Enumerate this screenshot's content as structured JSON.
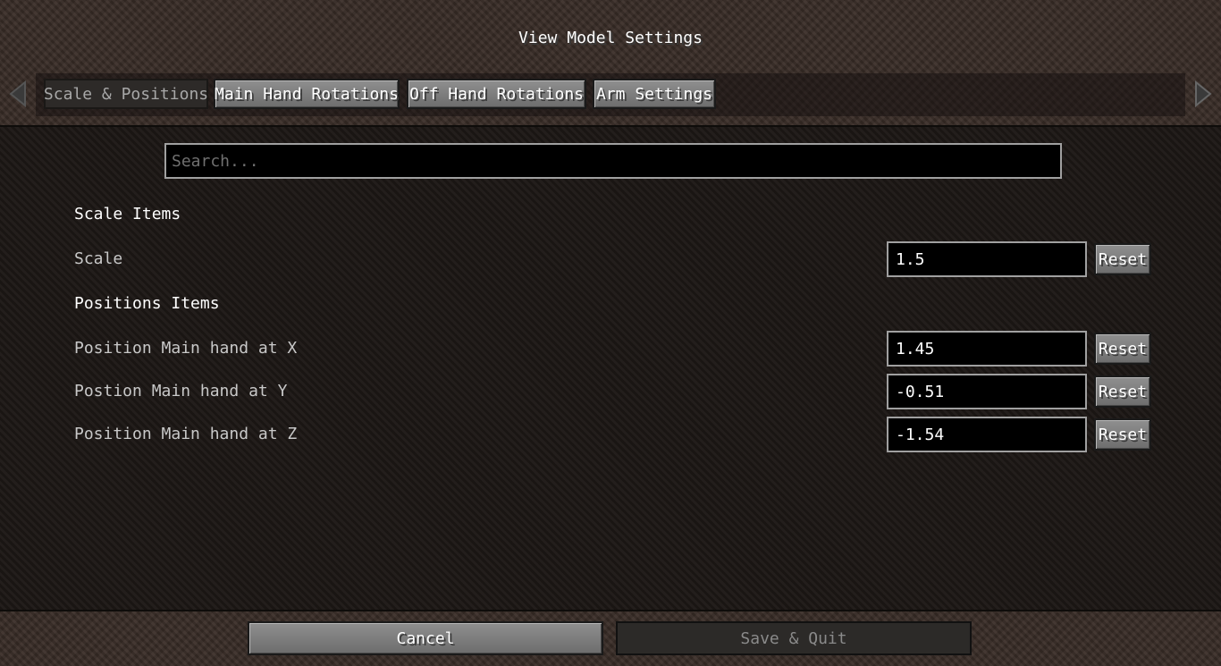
{
  "window": {
    "title": "View Model Settings"
  },
  "tabs": [
    {
      "label": "Scale & Positions",
      "active": true
    },
    {
      "label": "Main Hand Rotations",
      "active": false
    },
    {
      "label": "Off Hand Rotations",
      "active": false
    },
    {
      "label": "Arm Settings",
      "active": false
    }
  ],
  "search": {
    "placeholder": "Search...",
    "value": ""
  },
  "sections": {
    "scale": {
      "heading": "Scale Items",
      "rows": [
        {
          "label": "Scale",
          "value": "1.5",
          "reset_label": "Reset"
        }
      ]
    },
    "positions": {
      "heading": "Positions Items",
      "rows": [
        {
          "label": "Position Main hand at X",
          "value": "1.45",
          "reset_label": "Reset"
        },
        {
          "label": "Postion Main hand at Y",
          "value": "-0.51",
          "reset_label": "Reset"
        },
        {
          "label": "Position Main hand at Z",
          "value": "-1.54",
          "reset_label": "Reset"
        }
      ]
    }
  },
  "footer": {
    "cancel_label": "Cancel",
    "save_label": "Save & Quit"
  },
  "icons": {
    "prev": "triangle-left-icon",
    "next": "triangle-right-icon"
  },
  "colors": {
    "panel_bg": "#1f1a17",
    "button_bg": "#7f7f7f",
    "text_white": "#ffffff",
    "text_gray": "#c8c8c8"
  }
}
